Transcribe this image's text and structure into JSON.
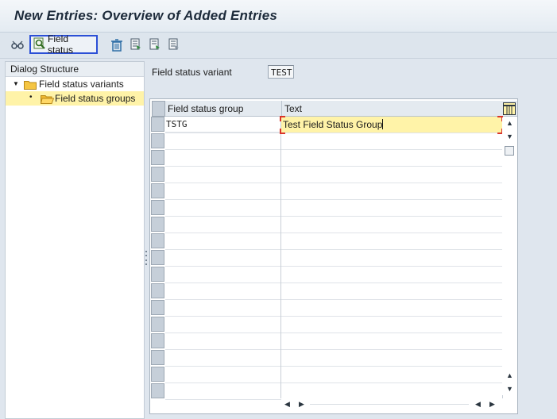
{
  "header": {
    "title": "New Entries: Overview of Added Entries"
  },
  "toolbar": {
    "field_status_label": "Field status",
    "icons": [
      "glasses-icon",
      "field-status-icon",
      "trash-icon",
      "select-all-icon",
      "select-block-icon",
      "deselect-icon"
    ]
  },
  "dialog_structure": {
    "title": "Dialog Structure",
    "items": [
      {
        "label": "Field status variants",
        "expanded": true
      },
      {
        "label": "Field status groups",
        "selected": true
      }
    ]
  },
  "variant": {
    "label": "Field status variant",
    "value": "TEST"
  },
  "table": {
    "columns": [
      "Field status group",
      "Text"
    ],
    "rows": [
      {
        "group": "TSTG",
        "text": "Test Field Status Group"
      }
    ]
  },
  "colors": {
    "selection": "#fff3a8",
    "focus_border": "#2b4fd6",
    "required_marker": "#d9342b"
  }
}
